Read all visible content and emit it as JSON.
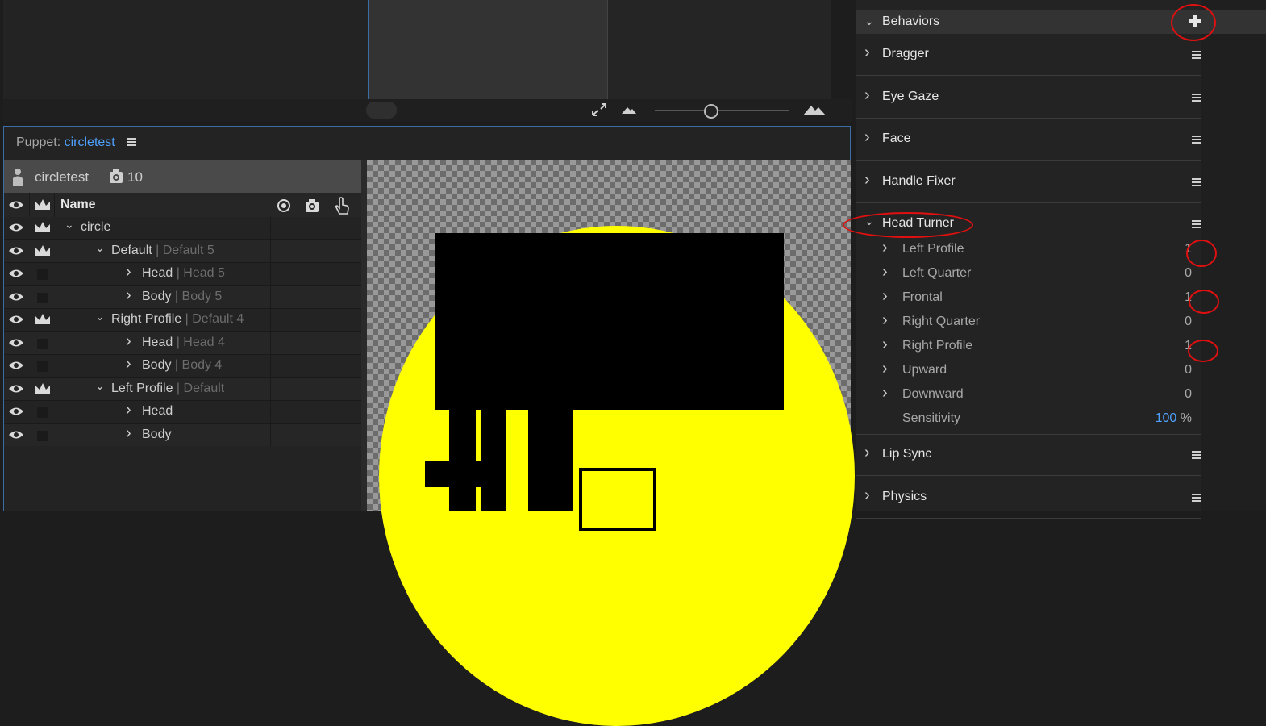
{
  "puppet_panel": {
    "title_prefix": "Puppet:",
    "puppet_name": "circletest",
    "layer_header": {
      "name": "circletest",
      "count": "10"
    },
    "column_header": {
      "name": "Name"
    },
    "layers": [
      {
        "name": "circle",
        "sub": "",
        "depth": 0,
        "expanded": true,
        "crown": true
      },
      {
        "name": "Default",
        "sub": "| Default 5",
        "depth": 1,
        "expanded": true,
        "crown": true
      },
      {
        "name": "Head",
        "sub": "| Head 5",
        "depth": 2,
        "expanded": false,
        "crown": false
      },
      {
        "name": "Body",
        "sub": "| Body 5",
        "depth": 2,
        "expanded": false,
        "crown": false
      },
      {
        "name": "Right Profile",
        "sub": "| Default 4",
        "depth": 1,
        "expanded": true,
        "crown": true
      },
      {
        "name": "Head",
        "sub": "| Head 4",
        "depth": 2,
        "expanded": false,
        "crown": false
      },
      {
        "name": "Body",
        "sub": "| Body 4",
        "depth": 2,
        "expanded": false,
        "crown": false
      },
      {
        "name": "Left Profile",
        "sub": "| Default",
        "depth": 1,
        "expanded": true,
        "crown": true
      },
      {
        "name": "Head",
        "sub": "",
        "depth": 2,
        "expanded": false,
        "crown": false
      },
      {
        "name": "Body",
        "sub": "",
        "depth": 2,
        "expanded": false,
        "crown": false
      }
    ]
  },
  "behaviors_panel": {
    "header": "Behaviors",
    "behaviors": [
      "Dragger",
      "Eye Gaze",
      "Face",
      "Handle Fixer",
      "Head Turner",
      "Lip Sync",
      "Physics"
    ],
    "head_turner_params": [
      {
        "label": "Left Profile",
        "value": "1"
      },
      {
        "label": "Left Quarter",
        "value": "0"
      },
      {
        "label": "Frontal",
        "value": "1"
      },
      {
        "label": "Right Quarter",
        "value": "0"
      },
      {
        "label": "Right Profile",
        "value": "1"
      },
      {
        "label": "Upward",
        "value": "0"
      },
      {
        "label": "Downward",
        "value": "0"
      }
    ],
    "sensitivity": {
      "label": "Sensitivity",
      "value": "100",
      "unit": "%"
    }
  },
  "colors": {
    "accent": "#4ea1ff",
    "annotation": "#e01010",
    "canvas_yellow": "#ffff00"
  }
}
